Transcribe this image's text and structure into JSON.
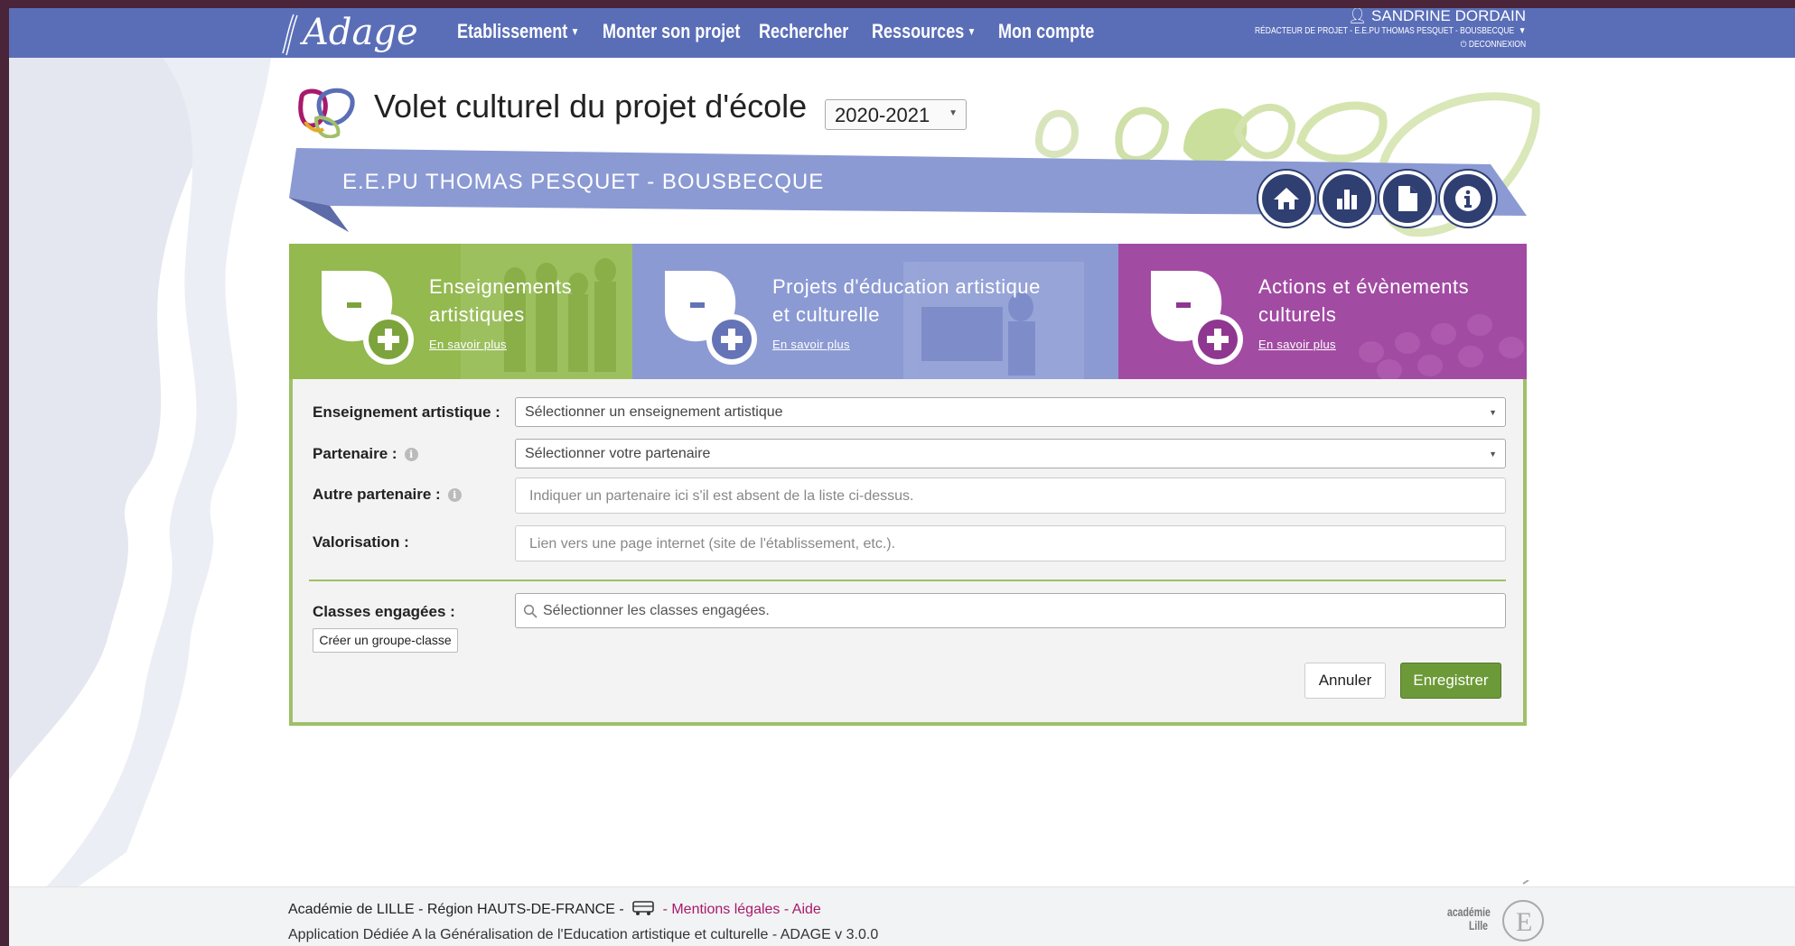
{
  "nav": {
    "logo_text": "Adage",
    "items": [
      {
        "label": "Etablissement",
        "has_caret": true
      },
      {
        "label": "Monter son projet",
        "has_caret": false
      },
      {
        "label": "Rechercher",
        "has_caret": false
      },
      {
        "label": "Ressources",
        "has_caret": true
      },
      {
        "label": "Mon compte",
        "has_caret": false
      }
    ],
    "user": {
      "name": "SANDRINE DORDAIN",
      "role": "RÉDACTEUR DE PROJET - E.E.PU THOMAS PESQUET - BOUSBECQUE",
      "logout": "DECONNEXION"
    }
  },
  "header": {
    "title": "Volet culturel du projet d'école",
    "year": "2020-2021",
    "school": "E.E.PU THOMAS PESQUET - BOUSBECQUE",
    "icons": [
      "home-icon",
      "bar-chart-icon",
      "document-icon",
      "info-icon"
    ]
  },
  "tabs": [
    {
      "line1": "Enseignements",
      "line2": "artistiques",
      "more": "En savoir plus",
      "color": "#93b94f"
    },
    {
      "line1": "Projets d'éducation artistique",
      "line2": "et culturelle",
      "more": "En savoir plus",
      "color": "#8b9ad3"
    },
    {
      "line1": "Actions et évènements",
      "line2": "culturels",
      "more": "En savoir plus",
      "color": "#a24ba3"
    }
  ],
  "form": {
    "enseignement_label": "Enseignement artistique :",
    "enseignement_placeholder": "Sélectionner un enseignement artistique",
    "partenaire_label": "Partenaire :",
    "partenaire_placeholder": "Sélectionner votre partenaire",
    "autre_label": "Autre partenaire :",
    "autre_placeholder": "Indiquer un partenaire ici s'il est absent de la liste ci-dessus.",
    "valorisation_label": "Valorisation :",
    "valorisation_placeholder": "Lien vers une page internet (site de l'établissement, etc.).",
    "classes_label": "Classes engagées :",
    "classes_placeholder": "Sélectionner les classes engagées.",
    "group_button": "Créer un groupe-classe",
    "cancel_button": "Annuler",
    "save_button": "Enregistrer"
  },
  "footer": {
    "line1_prefix": "Académie de LILLE - Région HAUTS-DE-FRANCE - ",
    "line1_sep": " - ",
    "mentions": "Mentions légales",
    "sep2": " - ",
    "aide": "Aide",
    "line2": "Application Dédiée A la Généralisation de l'Education artistique et culturelle - ADAGE v 3.0.0",
    "logo_line1": "académie",
    "logo_line2": "Lille"
  },
  "colors": {
    "nav": "#5a6eb8",
    "banner": "#8b9ad3",
    "green": "#9fc069",
    "save": "#6c9a38",
    "link": "#a8196b"
  }
}
